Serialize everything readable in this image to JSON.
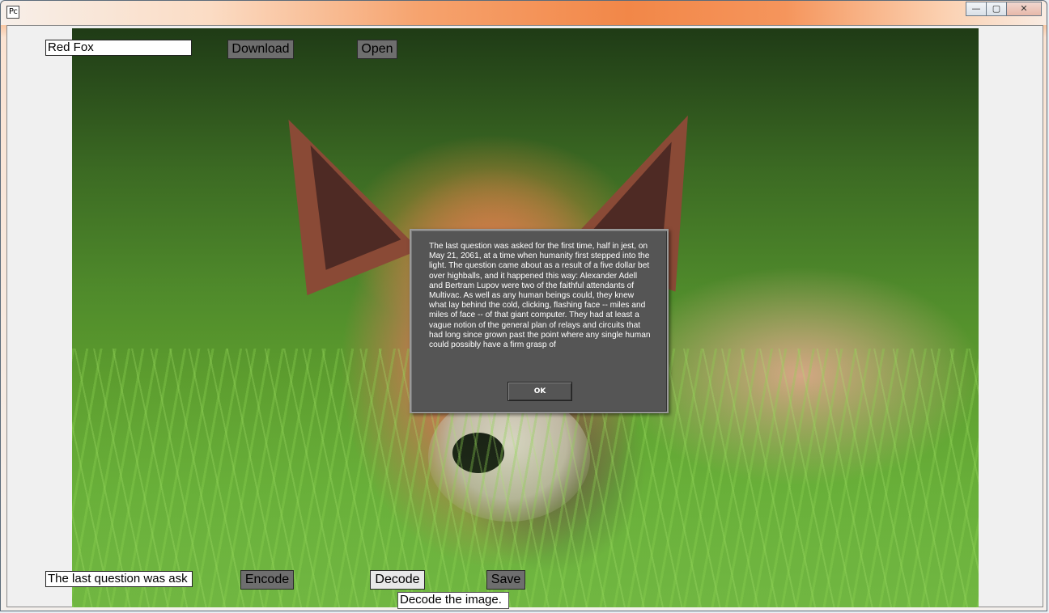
{
  "window": {
    "icon_text": "Pc",
    "controls": {
      "minimize": "—",
      "maximize": "▢",
      "close": "✕"
    }
  },
  "top_bar": {
    "name_field_value": "Red Fox",
    "download_label": "Download",
    "open_label": "Open"
  },
  "image": {
    "subject": "fox-photo"
  },
  "dialog": {
    "message": "The last question was asked for the first time, half in jest, on May 21, 2061, at a time when humanity first stepped into the light. The question came about as a result of a five dollar bet over highballs, and it happened this way: Alexander Adell and Bertram Lupov were two of the faithful attendants of Multivac. As well as any human beings could, they knew what lay behind the cold, clicking, flashing face -- miles and miles of face -- of that giant computer. They had at least a vague notion of the general plan of relays and circuits that had long since grown past the point where any single human could possibly have a firm grasp of",
    "ok_label": "OK"
  },
  "bottom_bar": {
    "message_field_value": "The last question was ask",
    "encode_label": "Encode",
    "decode_label": "Decode",
    "save_label": "Save",
    "status_text": "Decode the image."
  },
  "colors": {
    "dialog_bg": "#555555",
    "dark_button": "#6e6e6e",
    "light_button": "#e8e8e8"
  }
}
